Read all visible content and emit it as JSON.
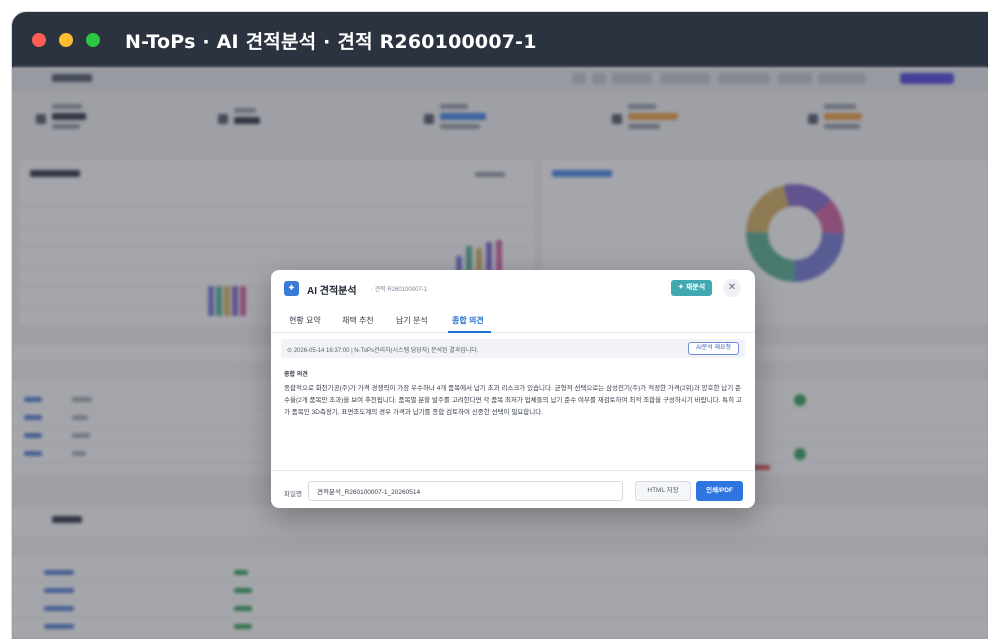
{
  "window": {
    "title": "N-ToPs · AI 견적분석 · 견적 R260100007-1"
  },
  "modal": {
    "title": "AI 견적분석",
    "subtitle": "· 견적 R260100007-1",
    "reanalyze_label": "✦ 재분석",
    "close_label": "✕",
    "logo_glyph": "✦",
    "tabs": [
      {
        "label": "현황 요약",
        "active": false
      },
      {
        "label": "채택 추천",
        "active": false
      },
      {
        "label": "납기 분석",
        "active": false
      },
      {
        "label": "종합 의견",
        "active": true
      }
    ],
    "info": {
      "text": "⊙ 2026-05-14 16:37:00 | N-ToPs관리자(시스템 담당자) 분석된 결과입니다.",
      "button_label": "AI분석 재요청"
    },
    "section_title": "종합 의견",
    "opinion": "종합적으로 화천기공(주)가 가격 경쟁력이 가장 우수하나 4개 품목에서 납기 초과 리스크가 있습니다. 균형적 선택으로는 삼성전기(주)가 적정한 가격(2위)과 양호한 납기 준수율(2개 품목만 초과)을 보여 추천됩니다. 품목별 분할 발주를 고려한다면 각 품목 최저가 업체들의 납기 준수 여부를 재검토하여 최적 조합을 구성하시기 바랍니다. 특히 고가 품목인 3D측정기, 표면조도계의 경우 가격과 납기를 종합 검토하여 신중한 선택이 필요합니다.",
    "footer": {
      "file_label": "파일명",
      "file_value": "견적분석_R260100007-1_20260514",
      "html_button": "HTML 저장",
      "pdf_button": "인쇄/PDF"
    }
  },
  "colors": {
    "primary": "#2f75e0",
    "accent_teal": "#3fa8b0",
    "titlebar": "#2c3340"
  }
}
